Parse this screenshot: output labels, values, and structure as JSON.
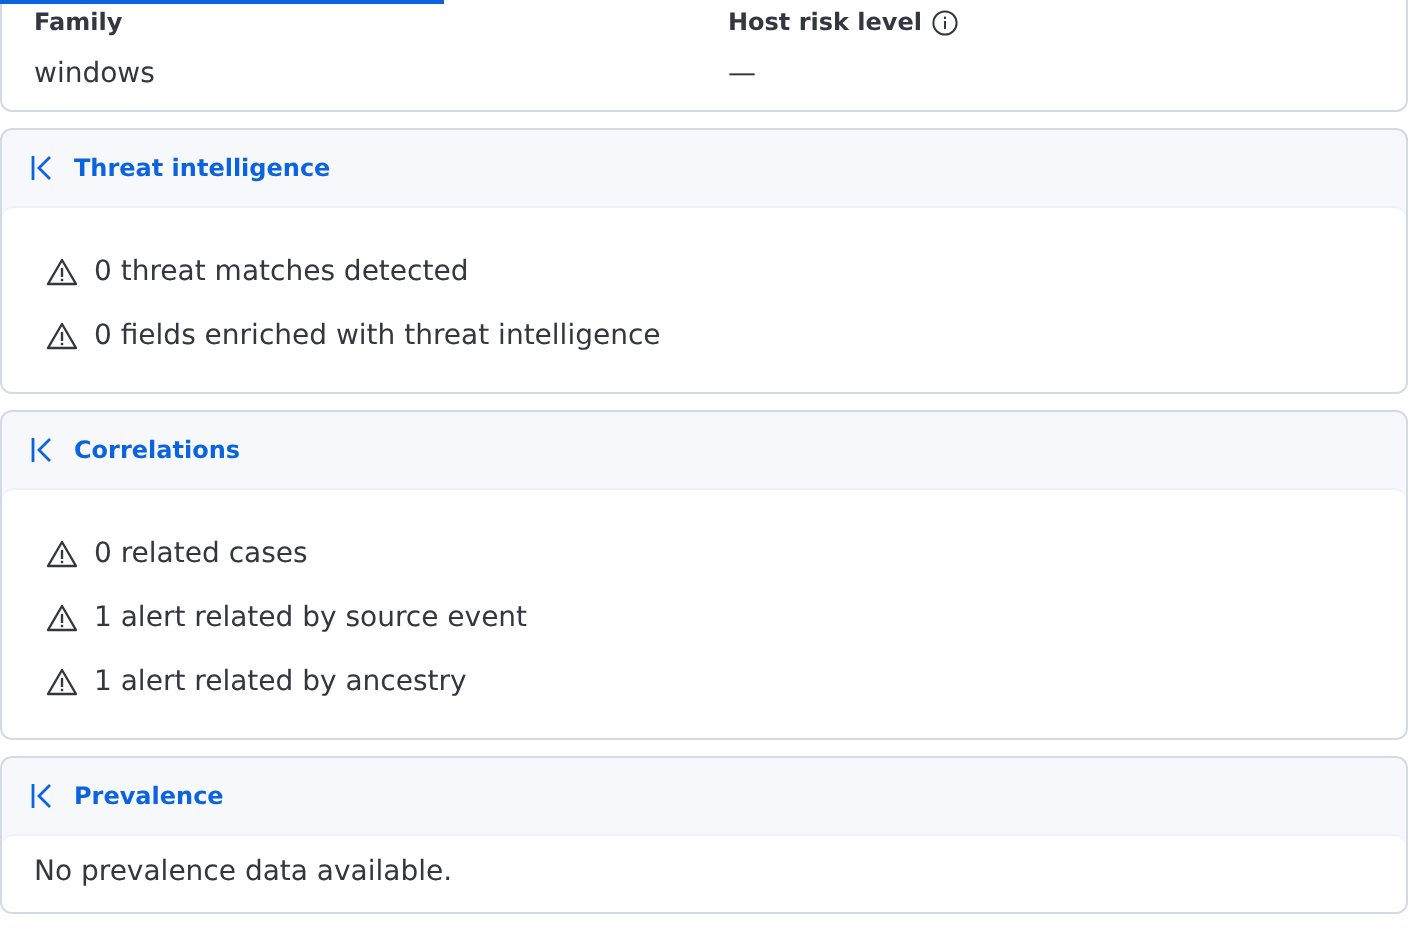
{
  "summary": {
    "fields": [
      {
        "label": "Family",
        "value": "windows",
        "info": false
      },
      {
        "label": "Host risk level",
        "value": "—",
        "info": true
      }
    ]
  },
  "sections": [
    {
      "title": "Threat intelligence",
      "kind": "list",
      "items": [
        "0 threat matches detected",
        "0 fields enriched with threat intelligence"
      ]
    },
    {
      "title": "Correlations",
      "kind": "list",
      "items": [
        "0 related cases",
        "1 alert related by source event",
        "1 alert related by ancestry"
      ]
    },
    {
      "title": "Prevalence",
      "kind": "message",
      "message": "No prevalence data available."
    }
  ]
}
